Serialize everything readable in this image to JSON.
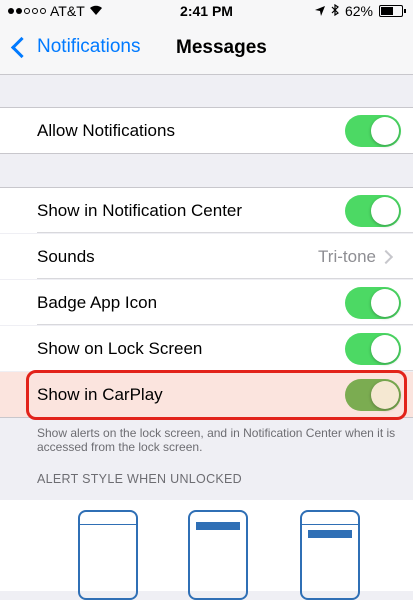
{
  "status_bar": {
    "carrier": "AT&T",
    "time": "2:41 PM",
    "battery": "62%",
    "battery_level": 0.62
  },
  "nav": {
    "back_label": "Notifications",
    "title": "Messages"
  },
  "cells": {
    "allow_notifications": {
      "label": "Allow Notifications",
      "on": true
    },
    "show_in_notification_center": {
      "label": "Show in Notification Center",
      "on": true
    },
    "sounds": {
      "label": "Sounds",
      "value": "Tri-tone"
    },
    "badge_app_icon": {
      "label": "Badge App Icon",
      "on": true
    },
    "show_on_lock_screen": {
      "label": "Show on Lock Screen",
      "on": true
    },
    "show_in_carplay": {
      "label": "Show in CarPlay",
      "on": true
    }
  },
  "footer": {
    "text": "Show alerts on the lock screen, and in Notification Center when it is accessed from the lock screen."
  },
  "alert_style": {
    "header": "ALERT STYLE WHEN UNLOCKED",
    "options": [
      "none",
      "banners",
      "alerts"
    ]
  },
  "colors": {
    "accent": "#007aff",
    "toggle_on": "#4cd964",
    "highlight_border": "#e2231a"
  }
}
